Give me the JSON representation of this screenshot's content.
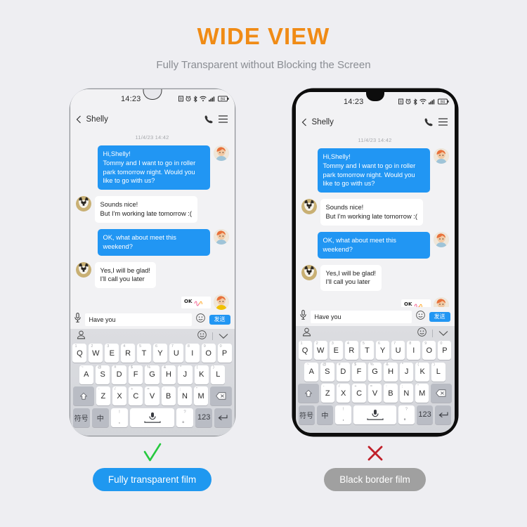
{
  "header": {
    "title": "WIDE VIEW",
    "subtitle": "Fully Transparent without Blocking the Screen",
    "title_color": "#f08b15",
    "subtitle_color": "#8a8d93"
  },
  "phone": {
    "status": {
      "time": "14:23",
      "battery_level": "84",
      "icons": [
        "sim-icon",
        "alarm-icon",
        "bluetooth-icon",
        "wifi-icon",
        "signal-icon",
        "battery-icon"
      ]
    },
    "chat_header": {
      "back_icon": "chevron-left-icon",
      "contact_name": "Shelly",
      "call_icon": "phone-icon",
      "menu_icon": "hamburger-menu-icon"
    },
    "conversation": {
      "datestamp": "11/4/23 14:42",
      "messages": [
        {
          "side": "out",
          "text": "Hi,Shelly!\nTommy and I want to go in roller park tomorrow night. Would you like to go with us?"
        },
        {
          "side": "in",
          "text": "Sounds nice!\nBut I'm working late tomorrow :("
        },
        {
          "side": "out",
          "text": "OK, what about meet this weekend?"
        },
        {
          "side": "in",
          "text": "Yes,I will be glad!\nI'll call you later"
        }
      ],
      "sticker_label": "OK",
      "bubble_out_color": "#2196f3",
      "bubble_in_color": "#ffffff"
    },
    "input_bar": {
      "mic_icon": "microphone-icon",
      "value": "Have you",
      "emoji_icon": "smiley-icon",
      "send_label": "发送",
      "send_color": "#2196f3"
    },
    "keyboard": {
      "toolbar": {
        "sticker_icon": "sticker-pack-icon",
        "emoji_icon": "smiley-icon",
        "collapse_icon": "chevron-down-icon"
      },
      "row1": [
        {
          "key": "Q",
          "sup": "1"
        },
        {
          "key": "W",
          "sup": "2"
        },
        {
          "key": "E",
          "sup": "3"
        },
        {
          "key": "R",
          "sup": "4"
        },
        {
          "key": "T",
          "sup": "5"
        },
        {
          "key": "Y",
          "sup": "6"
        },
        {
          "key": "U",
          "sup": "7"
        },
        {
          "key": "I",
          "sup": "8"
        },
        {
          "key": "O",
          "sup": "9"
        },
        {
          "key": "P",
          "sup": "0"
        }
      ],
      "row2": [
        {
          "key": "A",
          "sup": "~"
        },
        {
          "key": "S",
          "sup": "@"
        },
        {
          "key": "D",
          "sup": "#"
        },
        {
          "key": "F",
          "sup": "$"
        },
        {
          "key": "G",
          "sup": "%"
        },
        {
          "key": "H",
          "sup": "&"
        },
        {
          "key": "J",
          "sup": "*"
        },
        {
          "key": "K",
          "sup": "("
        },
        {
          "key": "L",
          "sup": ")"
        }
      ],
      "row3": [
        {
          "key": "Z",
          "sup": "-"
        },
        {
          "key": "X",
          "sup": "/"
        },
        {
          "key": "C",
          "sup": "+"
        },
        {
          "key": "V",
          "sup": "="
        },
        {
          "key": "B",
          "sup": ":"
        },
        {
          "key": "N",
          "sup": ";"
        },
        {
          "key": "M",
          "sup": "\""
        }
      ],
      "shift_icon": "shift-up-icon",
      "backspace_icon": "backspace-icon",
      "row4": {
        "symbols_label": "符号",
        "lang_label": "中",
        "comma_sup": "!",
        "comma_label": ",",
        "space_icon": "microphone-icon",
        "period_sup": "?",
        "period_label": "。",
        "numbers_label": "123",
        "enter_icon": "enter-icon"
      }
    }
  },
  "captions": {
    "left": {
      "mark": "check-mark",
      "mark_color": "#26c93f",
      "label": "Fully transparent film",
      "pill_color": "#1f98f0"
    },
    "right": {
      "mark": "cross-mark",
      "mark_color": "#c0202a",
      "label": "Black border film",
      "pill_color": "#a0a0a0"
    }
  }
}
